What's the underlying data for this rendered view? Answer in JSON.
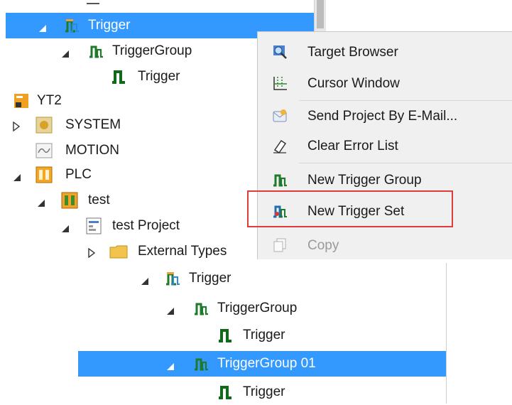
{
  "tree_top": {
    "items": [
      {
        "label": "Trigger",
        "type": "trigger-folder",
        "expanded": true,
        "selected": true
      },
      {
        "label": "TriggerGroup",
        "type": "trigger-group",
        "expanded": true
      },
      {
        "label": "Trigger",
        "type": "trigger"
      },
      {
        "label": "YT2",
        "type": "project"
      },
      {
        "label": "SYSTEM",
        "type": "system",
        "expanded": false
      },
      {
        "label": "MOTION",
        "type": "motion"
      },
      {
        "label": "PLC",
        "type": "plc",
        "expanded": true
      },
      {
        "label": "test",
        "type": "plc-project",
        "expanded": true
      },
      {
        "label": "test Project",
        "type": "project-file",
        "expanded": true
      },
      {
        "label": "External Types",
        "type": "folder",
        "expanded": false
      }
    ]
  },
  "context_menu": {
    "items": [
      {
        "label": "Target Browser",
        "icon": "target-browser-icon",
        "enabled": true
      },
      {
        "label": "Cursor Window",
        "icon": "cursor-window-icon",
        "enabled": true
      },
      {
        "label": "Send Project By E-Mail...",
        "icon": "email-icon",
        "enabled": true
      },
      {
        "label": "Clear Error List",
        "icon": "eraser-icon",
        "enabled": true
      },
      {
        "label": "New Trigger Group",
        "icon": "trigger-group-icon",
        "enabled": true
      },
      {
        "label": "New Trigger Set",
        "icon": "trigger-set-icon",
        "enabled": true,
        "highlighted": true
      },
      {
        "label": "Copy",
        "icon": "copy-icon",
        "enabled": false
      }
    ]
  },
  "tree_bottom": {
    "items": [
      {
        "label": "Trigger",
        "type": "trigger-folder",
        "expanded": true
      },
      {
        "label": "TriggerGroup",
        "type": "trigger-group",
        "expanded": true
      },
      {
        "label": "Trigger",
        "type": "trigger"
      },
      {
        "label": "TriggerGroup 01",
        "type": "trigger-group",
        "expanded": true,
        "selected": true
      },
      {
        "label": "Trigger",
        "type": "trigger"
      }
    ]
  },
  "colors": {
    "selection": "#3399ff",
    "trigger_green": "#1f7a1f",
    "highlight_border": "#e23b3b",
    "menu_bg": "#f0f0f0"
  }
}
